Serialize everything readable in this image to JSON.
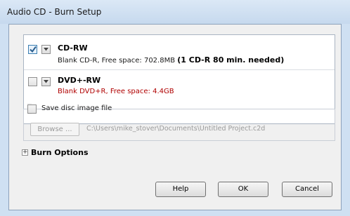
{
  "window": {
    "title": "Audio CD - Burn Setup"
  },
  "drives": [
    {
      "name": "CD-RW",
      "checked": true,
      "info": "Blank CD-R, Free space: 702.8MB",
      "needed": "(1 CD-R 80 min. needed)",
      "info_color": "#1a1a1a"
    },
    {
      "name": "DVD+-RW",
      "checked": false,
      "info": "Blank DVD+R, Free space: 4.4GB",
      "info_color": "#b00000"
    }
  ],
  "disc_image": {
    "label": "Save disc image file",
    "checked": false,
    "browse_label": "Browse ...",
    "path": "C:\\Users\\mike_stover\\Documents\\Untitled Project.c2d"
  },
  "burn_options": {
    "label": "Burn Options",
    "expander_glyph": "+"
  },
  "buttons": {
    "help": "Help",
    "ok": "OK",
    "cancel": "Cancel"
  },
  "icons": {
    "checkmark": "checkmark-icon",
    "dropdown": "dropdown-arrow-icon",
    "expand": "expand-plus-icon"
  },
  "colors": {
    "title_bar": "#cfe0f2",
    "error_text": "#b00000",
    "disabled_text": "#9a9a9a"
  }
}
